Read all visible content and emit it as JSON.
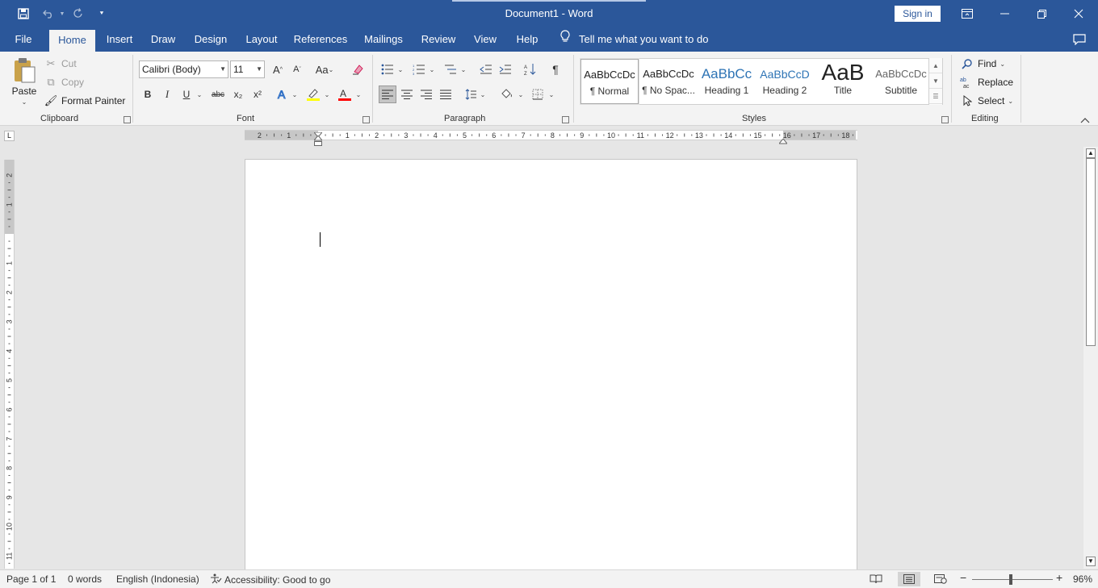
{
  "titlebar": {
    "title": "Document1  -  Word",
    "sign_in": "Sign in",
    "icons": [
      "save-icon",
      "undo-icon",
      "redo-icon",
      "customize-quick-access-icon",
      "ribbon-display-options-icon",
      "minimize-icon",
      "restore-icon",
      "close-icon"
    ]
  },
  "menu": {
    "tabs": [
      "File",
      "Home",
      "Insert",
      "Draw",
      "Design",
      "Layout",
      "References",
      "Mailings",
      "Review",
      "View",
      "Help"
    ],
    "active_tab": "Home",
    "tell_me": "Tell me what you want to do"
  },
  "ribbon": {
    "clipboard": {
      "label": "Clipboard",
      "paste": "Paste",
      "cut": "Cut",
      "copy": "Copy",
      "format_painter": "Format Painter"
    },
    "font": {
      "label": "Font",
      "font_name": "Calibri (Body)",
      "font_size": "11",
      "bold": "B",
      "italic": "I",
      "underline": "U",
      "strikethrough": "abc",
      "subscript": "x₂",
      "superscript": "x²",
      "change_case": "Aa",
      "grow_font": "A",
      "shrink_font": "A"
    },
    "paragraph": {
      "label": "Paragraph",
      "show_marks": "¶"
    },
    "styles": {
      "label": "Styles",
      "items": [
        {
          "preview": "AaBbCcDc",
          "name": "¶ Normal"
        },
        {
          "preview": "AaBbCcDc",
          "name": "¶ No Spac..."
        },
        {
          "preview": "AaBbCc",
          "name": "Heading 1"
        },
        {
          "preview": "AaBbCcD",
          "name": "Heading 2"
        },
        {
          "preview": "AaB",
          "name": "Title"
        },
        {
          "preview": "AaBbCcDc",
          "name": "Subtitle"
        }
      ],
      "selected": "¶ Normal"
    },
    "editing": {
      "label": "Editing",
      "find": "Find",
      "replace": "Replace",
      "select": "Select"
    }
  },
  "ruler": {
    "corner": "L",
    "h_labels": [
      "2",
      "1",
      "",
      "1",
      "2",
      "3",
      "4",
      "5",
      "6",
      "7",
      "8",
      "9",
      "10",
      "11",
      "12",
      "13",
      "14",
      "15",
      "16",
      "17",
      "18"
    ],
    "v_labels": [
      "2",
      "1",
      "",
      "1",
      "2",
      "3",
      "4",
      "5",
      "6",
      "7",
      "8",
      "9",
      "10",
      "11"
    ]
  },
  "statusbar": {
    "page": "Page 1 of 1",
    "words": "0 words",
    "language": "English (Indonesia)",
    "accessibility": "Accessibility: Good to go",
    "zoom": "96%",
    "zoom_minus": "−",
    "zoom_plus": "+"
  },
  "colors": {
    "brand": "#2b579a",
    "ribbon_bg": "#f3f3f3",
    "highlight": "#ffff00",
    "font_color": "#ff0000"
  }
}
